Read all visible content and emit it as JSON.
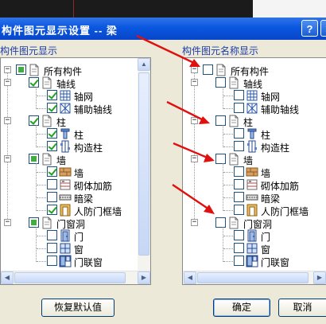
{
  "dialog": {
    "title": "构件图元显示设置  --  梁",
    "help_label": "?",
    "close_label": "✕"
  },
  "left_group": {
    "label": "构件图元显示",
    "items": [
      {
        "label": "所有构件",
        "level": 0,
        "expanded": true,
        "state": "partial",
        "icon": "doc-icon"
      },
      {
        "label": "轴线",
        "level": 1,
        "expanded": true,
        "state": "checked",
        "icon": "doc-icon"
      },
      {
        "label": "轴网",
        "level": 2,
        "state": "checked",
        "icon": "grid-icon"
      },
      {
        "label": "辅助轴线",
        "level": 2,
        "state": "checked",
        "icon": "aux-axis-icon"
      },
      {
        "label": "柱",
        "level": 1,
        "expanded": true,
        "state": "checked",
        "icon": "doc-icon"
      },
      {
        "label": "柱",
        "level": 2,
        "state": "checked",
        "icon": "column-icon"
      },
      {
        "label": "构造柱",
        "level": 2,
        "state": "checked",
        "icon": "struct-column-icon"
      },
      {
        "label": "墙",
        "level": 1,
        "expanded": true,
        "state": "partial",
        "icon": "doc-icon"
      },
      {
        "label": "墙",
        "level": 2,
        "state": "checked",
        "icon": "wall-icon"
      },
      {
        "label": "砌体加筋",
        "level": 2,
        "state": "unchecked",
        "icon": "masonry-rebar-icon"
      },
      {
        "label": "暗梁",
        "level": 2,
        "state": "unchecked",
        "icon": "hidden-beam-icon"
      },
      {
        "label": "人防门框墙",
        "level": 2,
        "state": "checked",
        "icon": "door-frame-wall-icon"
      },
      {
        "label": "门窗洞",
        "level": 1,
        "expanded": true,
        "state": "partial",
        "icon": "doc-icon"
      },
      {
        "label": "门",
        "level": 2,
        "state": "unchecked",
        "icon": "door-icon"
      },
      {
        "label": "窗",
        "level": 2,
        "state": "unchecked",
        "icon": "window-icon"
      },
      {
        "label": "门联窗",
        "level": 2,
        "state": "unchecked",
        "icon": "door-window-icon"
      }
    ]
  },
  "right_group": {
    "label": "构件图元名称显示",
    "items": [
      {
        "label": "所有构件",
        "level": 0,
        "expanded": true,
        "state": "unchecked",
        "icon": "doc-icon"
      },
      {
        "label": "轴线",
        "level": 1,
        "expanded": true,
        "state": "unchecked",
        "icon": "doc-icon"
      },
      {
        "label": "轴网",
        "level": 2,
        "state": "unchecked",
        "icon": "grid-icon"
      },
      {
        "label": "辅助轴线",
        "level": 2,
        "state": "unchecked",
        "icon": "aux-axis-icon"
      },
      {
        "label": "柱",
        "level": 1,
        "expanded": true,
        "state": "unchecked",
        "icon": "doc-icon"
      },
      {
        "label": "柱",
        "level": 2,
        "state": "unchecked",
        "icon": "column-icon"
      },
      {
        "label": "构造柱",
        "level": 2,
        "state": "unchecked",
        "icon": "struct-column-icon"
      },
      {
        "label": "墙",
        "level": 1,
        "expanded": true,
        "state": "unchecked",
        "icon": "doc-icon"
      },
      {
        "label": "墙",
        "level": 2,
        "state": "unchecked",
        "icon": "wall-icon"
      },
      {
        "label": "砌体加筋",
        "level": 2,
        "state": "unchecked",
        "icon": "masonry-rebar-icon"
      },
      {
        "label": "暗梁",
        "level": 2,
        "state": "unchecked",
        "icon": "hidden-beam-icon"
      },
      {
        "label": "人防门框墙",
        "level": 2,
        "state": "unchecked",
        "icon": "door-frame-wall-icon"
      },
      {
        "label": "门窗洞",
        "level": 1,
        "expanded": true,
        "state": "unchecked",
        "icon": "doc-icon"
      },
      {
        "label": "门",
        "level": 2,
        "state": "unchecked",
        "icon": "door-icon"
      },
      {
        "label": "窗",
        "level": 2,
        "state": "unchecked",
        "icon": "window-icon"
      },
      {
        "label": "门联窗",
        "level": 2,
        "state": "unchecked",
        "icon": "door-window-icon"
      }
    ]
  },
  "buttons": {
    "restore_defaults": "恢复默认值",
    "ok": "确定",
    "cancel": "取消"
  },
  "colors": {
    "titlebar": "#0a57e0",
    "annotation_arrow": "#e01010",
    "check_green": "#21a121"
  }
}
